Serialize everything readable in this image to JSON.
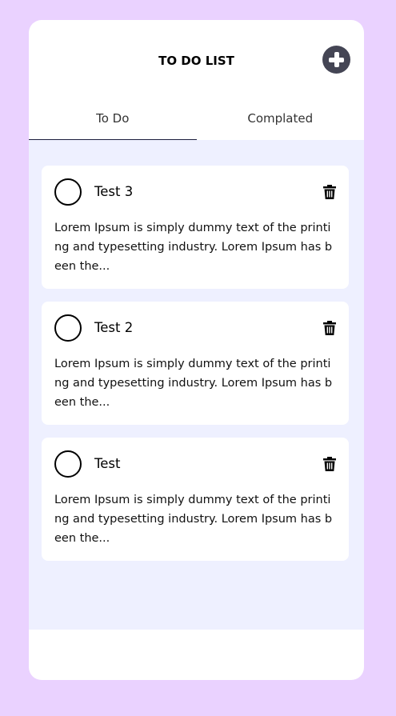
{
  "header": {
    "title": "TO DO LIST",
    "add_icon": "plus-circle-icon"
  },
  "tabs": [
    {
      "label": "To Do",
      "active": true
    },
    {
      "label": "Complated",
      "active": false
    }
  ],
  "tasks": [
    {
      "title": "Test 3",
      "description": "Lorem Ipsum is simply dummy text of the printing and typesetting industry. Lorem Ipsum has been the..."
    },
    {
      "title": "Test 2",
      "description": "Lorem Ipsum is simply dummy text of the printing and typesetting industry. Lorem Ipsum has been the..."
    },
    {
      "title": "Test",
      "description": "Lorem Ipsum is simply dummy text of the printing and typesetting industry. Lorem Ipsum has been the..."
    }
  ],
  "colors": {
    "background": "#ead2ff",
    "content_bg": "#eef0ff",
    "card": "#ffffff",
    "add_button": "#444554",
    "tab_underline": "#1b1e3d"
  }
}
